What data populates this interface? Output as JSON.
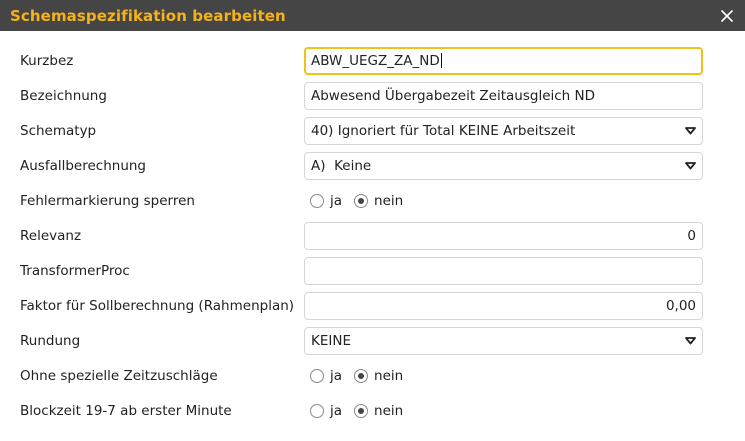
{
  "dialog": {
    "title": "Schemaspezifikation bearbeiten",
    "colors": {
      "titlebar_bg": "#454545",
      "title_text": "#f6b21a",
      "focus_border": "#f1c21b"
    }
  },
  "fields": {
    "kurzbez": {
      "label": "Kurzbez",
      "value": "ABW_UEGZ_ZA_ND"
    },
    "bezeichnung": {
      "label": "Bezeichnung",
      "value": "Abwesend Übergabezeit Zeitausgleich ND"
    },
    "schematyp": {
      "label": "Schematyp",
      "value": "40) Ignoriert für Total KEINE Arbeitszeit"
    },
    "ausfallberechnung": {
      "label": "Ausfallberechnung",
      "value": "A)  Keine"
    },
    "fehlermarkierung": {
      "label": "Fehlermarkierung sperren",
      "option_yes": "ja",
      "option_no": "nein",
      "selected": "nein"
    },
    "relevanz": {
      "label": "Relevanz",
      "value": "0"
    },
    "transformerproc": {
      "label": "TransformerProc",
      "value": ""
    },
    "faktor": {
      "label": "Faktor für Sollberechnung (Rahmenplan)",
      "value": "0,00"
    },
    "rundung": {
      "label": "Rundung",
      "value": "KEINE"
    },
    "zeitzuschlaege": {
      "label": "Ohne spezielle Zeitzuschläge",
      "option_yes": "ja",
      "option_no": "nein",
      "selected": "nein"
    },
    "blockzeit": {
      "label": "Blockzeit 19-7 ab erster Minute",
      "option_yes": "ja",
      "option_no": "nein",
      "selected": "nein"
    }
  },
  "icons": {
    "close": "close-icon",
    "dropdown": "chevron-down-icon"
  }
}
